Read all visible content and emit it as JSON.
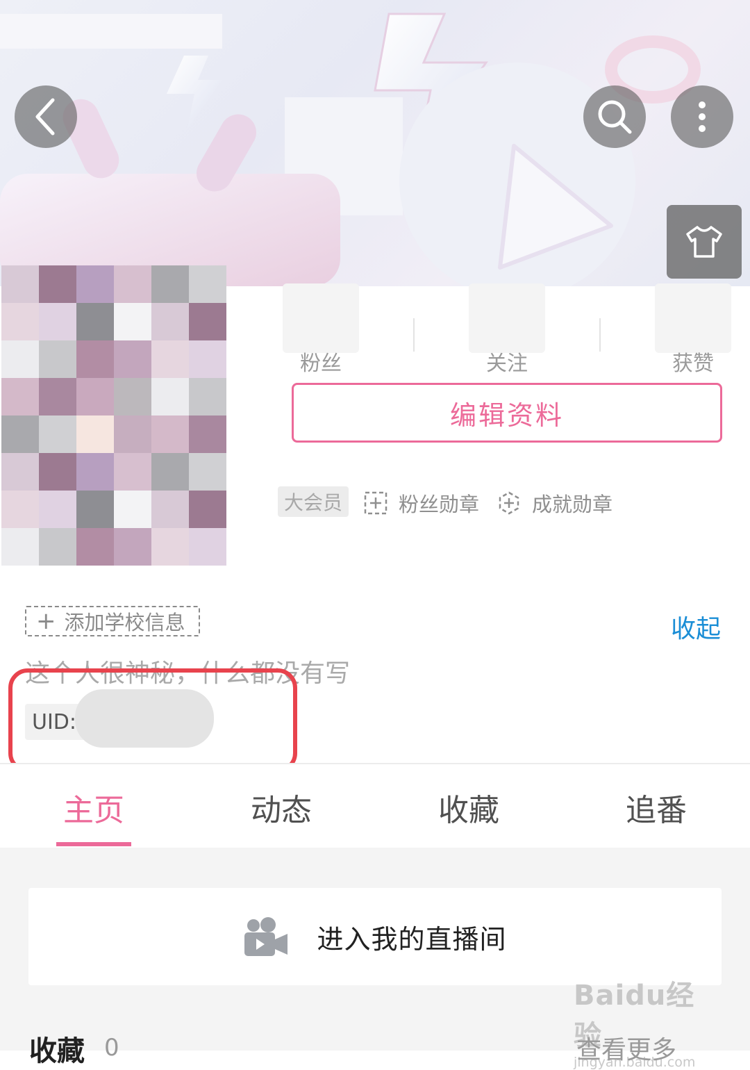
{
  "header": {
    "back_icon": "chevron-left-icon",
    "search_icon": "search-icon",
    "more_icon": "vertical-dots-icon",
    "skin_icon": "tshirt-icon"
  },
  "stats": [
    {
      "label": "粉丝"
    },
    {
      "label": "关注"
    },
    {
      "label": "获赞"
    }
  ],
  "profile": {
    "edit_label": "编辑资料",
    "vip_label": "大会员",
    "fan_medal_label": "粉丝勋章",
    "achievement_medal_label": "成就勋章",
    "add_school_label": "添加学校信息",
    "collapse_label": "收起",
    "bio": "这个人很神秘，什么都没有写",
    "uid_label": "UID:"
  },
  "tabs": [
    {
      "label": "主页",
      "active": true
    },
    {
      "label": "动态",
      "active": false
    },
    {
      "label": "收藏",
      "active": false
    },
    {
      "label": "追番",
      "active": false
    }
  ],
  "live": {
    "label": "进入我的直播间",
    "icon": "video-camera-icon"
  },
  "favorites": {
    "title": "收藏",
    "count": "0",
    "more_label": "查看更多"
  },
  "watermark": {
    "brand": "Baidu经验",
    "url": "jingyan.baidu.com"
  },
  "colors": {
    "accent": "#ec6a99",
    "link": "#1b8ed6",
    "highlight": "#e8434d"
  }
}
